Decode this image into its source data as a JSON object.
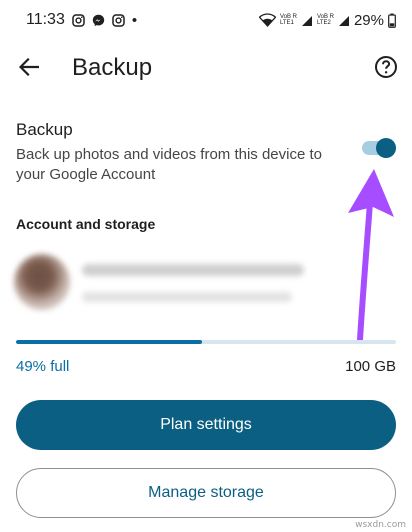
{
  "status_bar": {
    "time": "11:33",
    "dot": "•",
    "battery": "29%",
    "net1_top": "VoB R",
    "net1_bottom": "LTE1",
    "net2_top": "VoB R",
    "net2_bottom": "LTE2",
    "icons": [
      "instagram-icon",
      "messenger-icon",
      "instagram-icon",
      "wifi-icon",
      "signal-icon",
      "battery-icon"
    ]
  },
  "app_bar": {
    "title": "Backup",
    "back_icon": "arrow-left-icon",
    "help_icon": "help-circle-icon"
  },
  "backup": {
    "title": "Backup",
    "description": "Back up photos and videos from this device to your Google Account",
    "toggle_on": true
  },
  "account_section": {
    "heading": "Account and storage"
  },
  "storage": {
    "used_label": "49% full",
    "used_fraction": 0.49,
    "total_label": "100 GB"
  },
  "buttons": {
    "plan_settings": "Plan settings",
    "manage_storage": "Manage storage"
  },
  "colors": {
    "accent": "#0b5f83",
    "progress": "#0b6ea5",
    "annotation_arrow": "#a64dff"
  },
  "watermark": "wsxdn.com"
}
